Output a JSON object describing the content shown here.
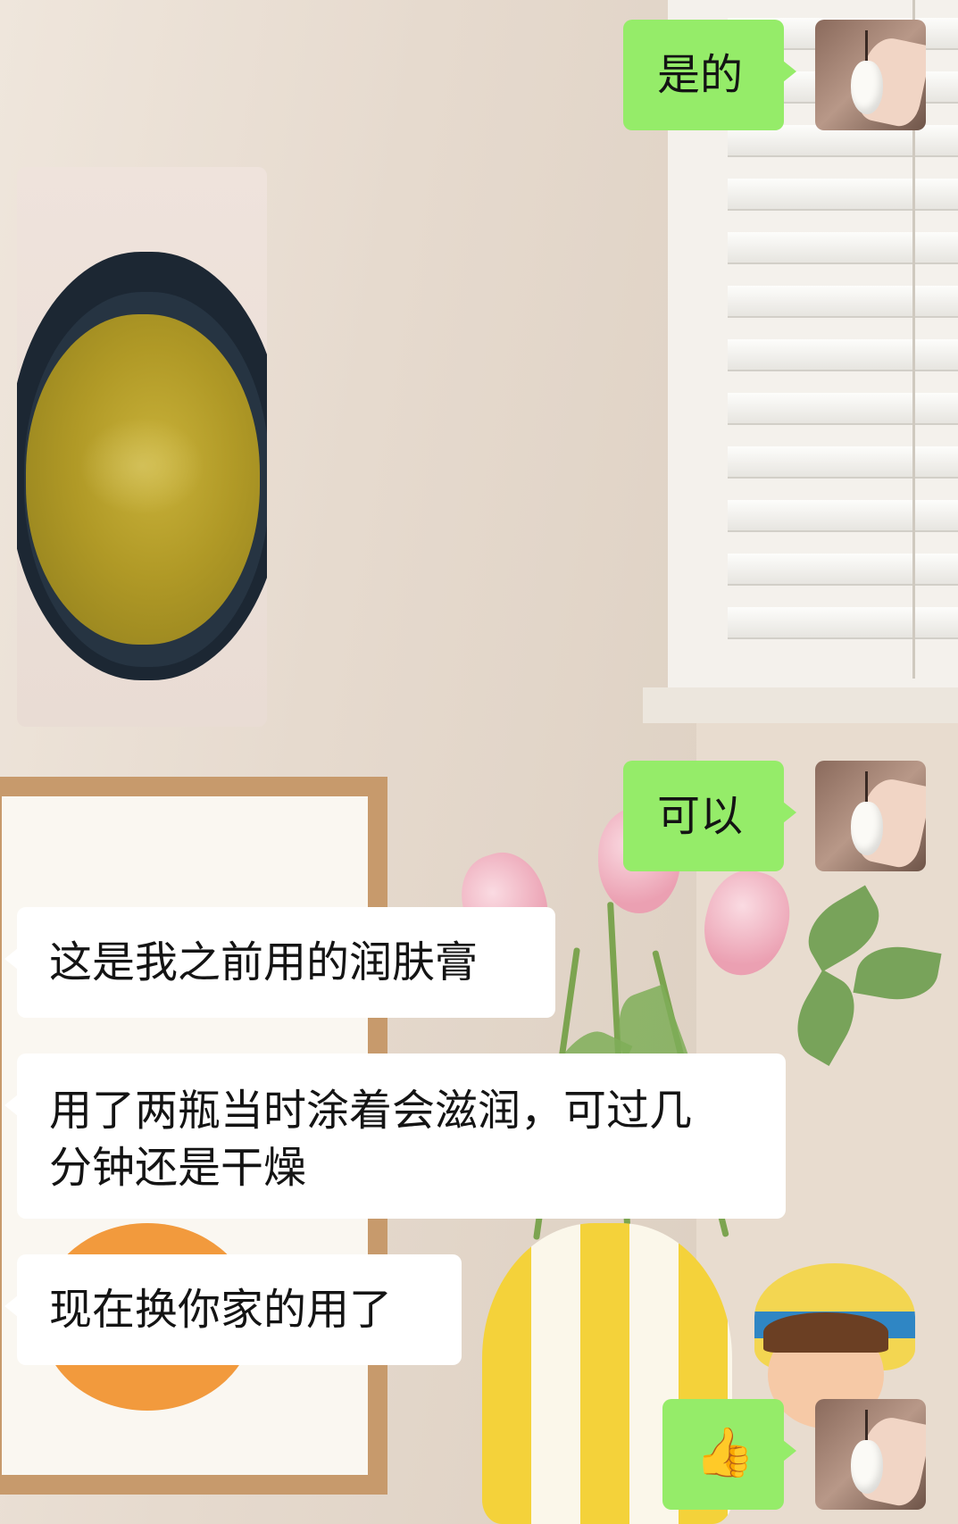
{
  "chat": {
    "messages": [
      {
        "id": "m1",
        "side": "out",
        "type": "text",
        "text": "是的"
      },
      {
        "id": "m2",
        "side": "in",
        "type": "image",
        "content": "cream-jar-photo"
      },
      {
        "id": "m3",
        "side": "out",
        "type": "text",
        "text": "可以"
      },
      {
        "id": "m4",
        "side": "in",
        "type": "text",
        "text": "这是我之前用的润肤膏"
      },
      {
        "id": "m5",
        "side": "in",
        "type": "text",
        "lines": [
          "用了两瓶当时涂着会滋润，可过几",
          "分钟还是干燥"
        ]
      },
      {
        "id": "m6",
        "side": "in",
        "type": "text",
        "text": "现在换你家的用了"
      },
      {
        "id": "m7",
        "side": "out",
        "type": "emoji",
        "text": "👍"
      }
    ]
  },
  "colors": {
    "outgoing_bubble": "#95ec69",
    "incoming_bubble": "#ffffff"
  },
  "icons": {
    "user_avatar": "jade-pendant-avatar",
    "emoji": "thumbs-up"
  }
}
